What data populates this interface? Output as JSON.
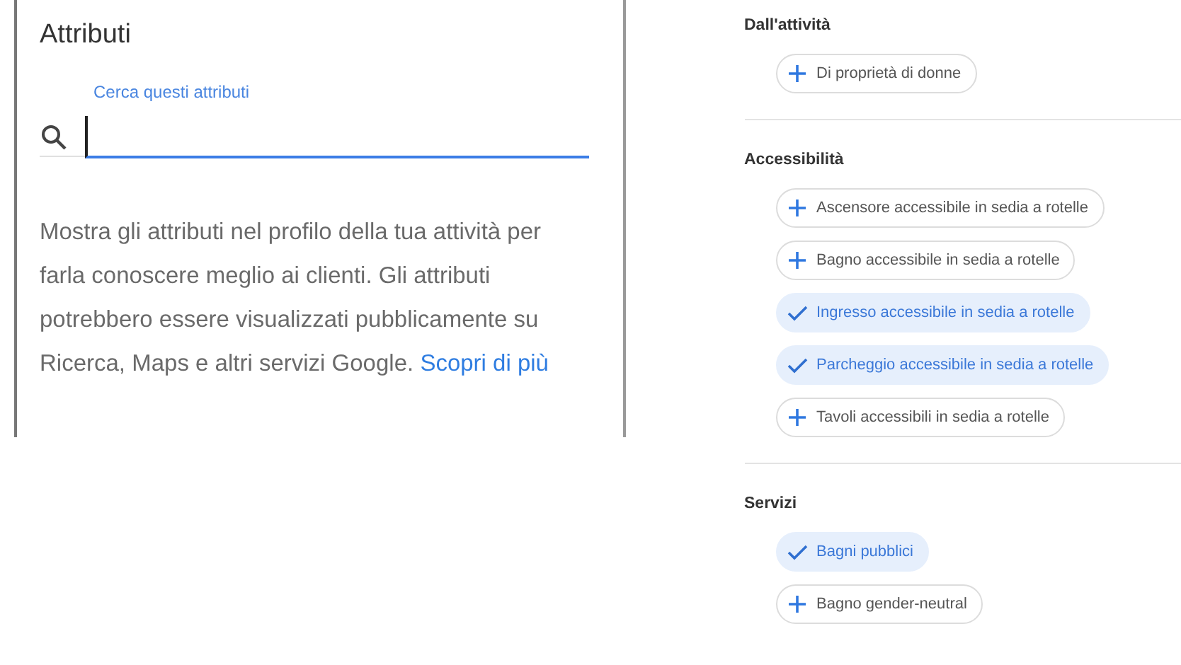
{
  "panel": {
    "title": "Attributi",
    "search": {
      "label": "Cerca questi attributi"
    },
    "description": "Mostra gli attributi nel profilo della tua attività per farla conoscere meglio ai clienti. Gli attributi potrebbero essere visualizzati pubblicamente su Ricerca, Maps e altri servizi Google.",
    "link": "Scopri di più"
  },
  "sections": [
    {
      "heading": "Dall'attività",
      "chips": [
        {
          "label": "Di proprietà di donne",
          "selected": false
        }
      ]
    },
    {
      "heading": "Accessibilità",
      "chips": [
        {
          "label": "Ascensore accessibile in sedia a rotelle",
          "selected": false
        },
        {
          "label": "Bagno accessibile in sedia a rotelle",
          "selected": false
        },
        {
          "label": "Ingresso accessibile in sedia a rotelle",
          "selected": true
        },
        {
          "label": "Parcheggio accessibile in sedia a rotelle",
          "selected": true
        },
        {
          "label": "Tavoli accessibili in sedia a rotelle",
          "selected": false
        }
      ]
    },
    {
      "heading": "Servizi",
      "chips": [
        {
          "label": "Bagni pubblici",
          "selected": true
        },
        {
          "label": "Bagno gender-neutral",
          "selected": false
        }
      ]
    }
  ]
}
